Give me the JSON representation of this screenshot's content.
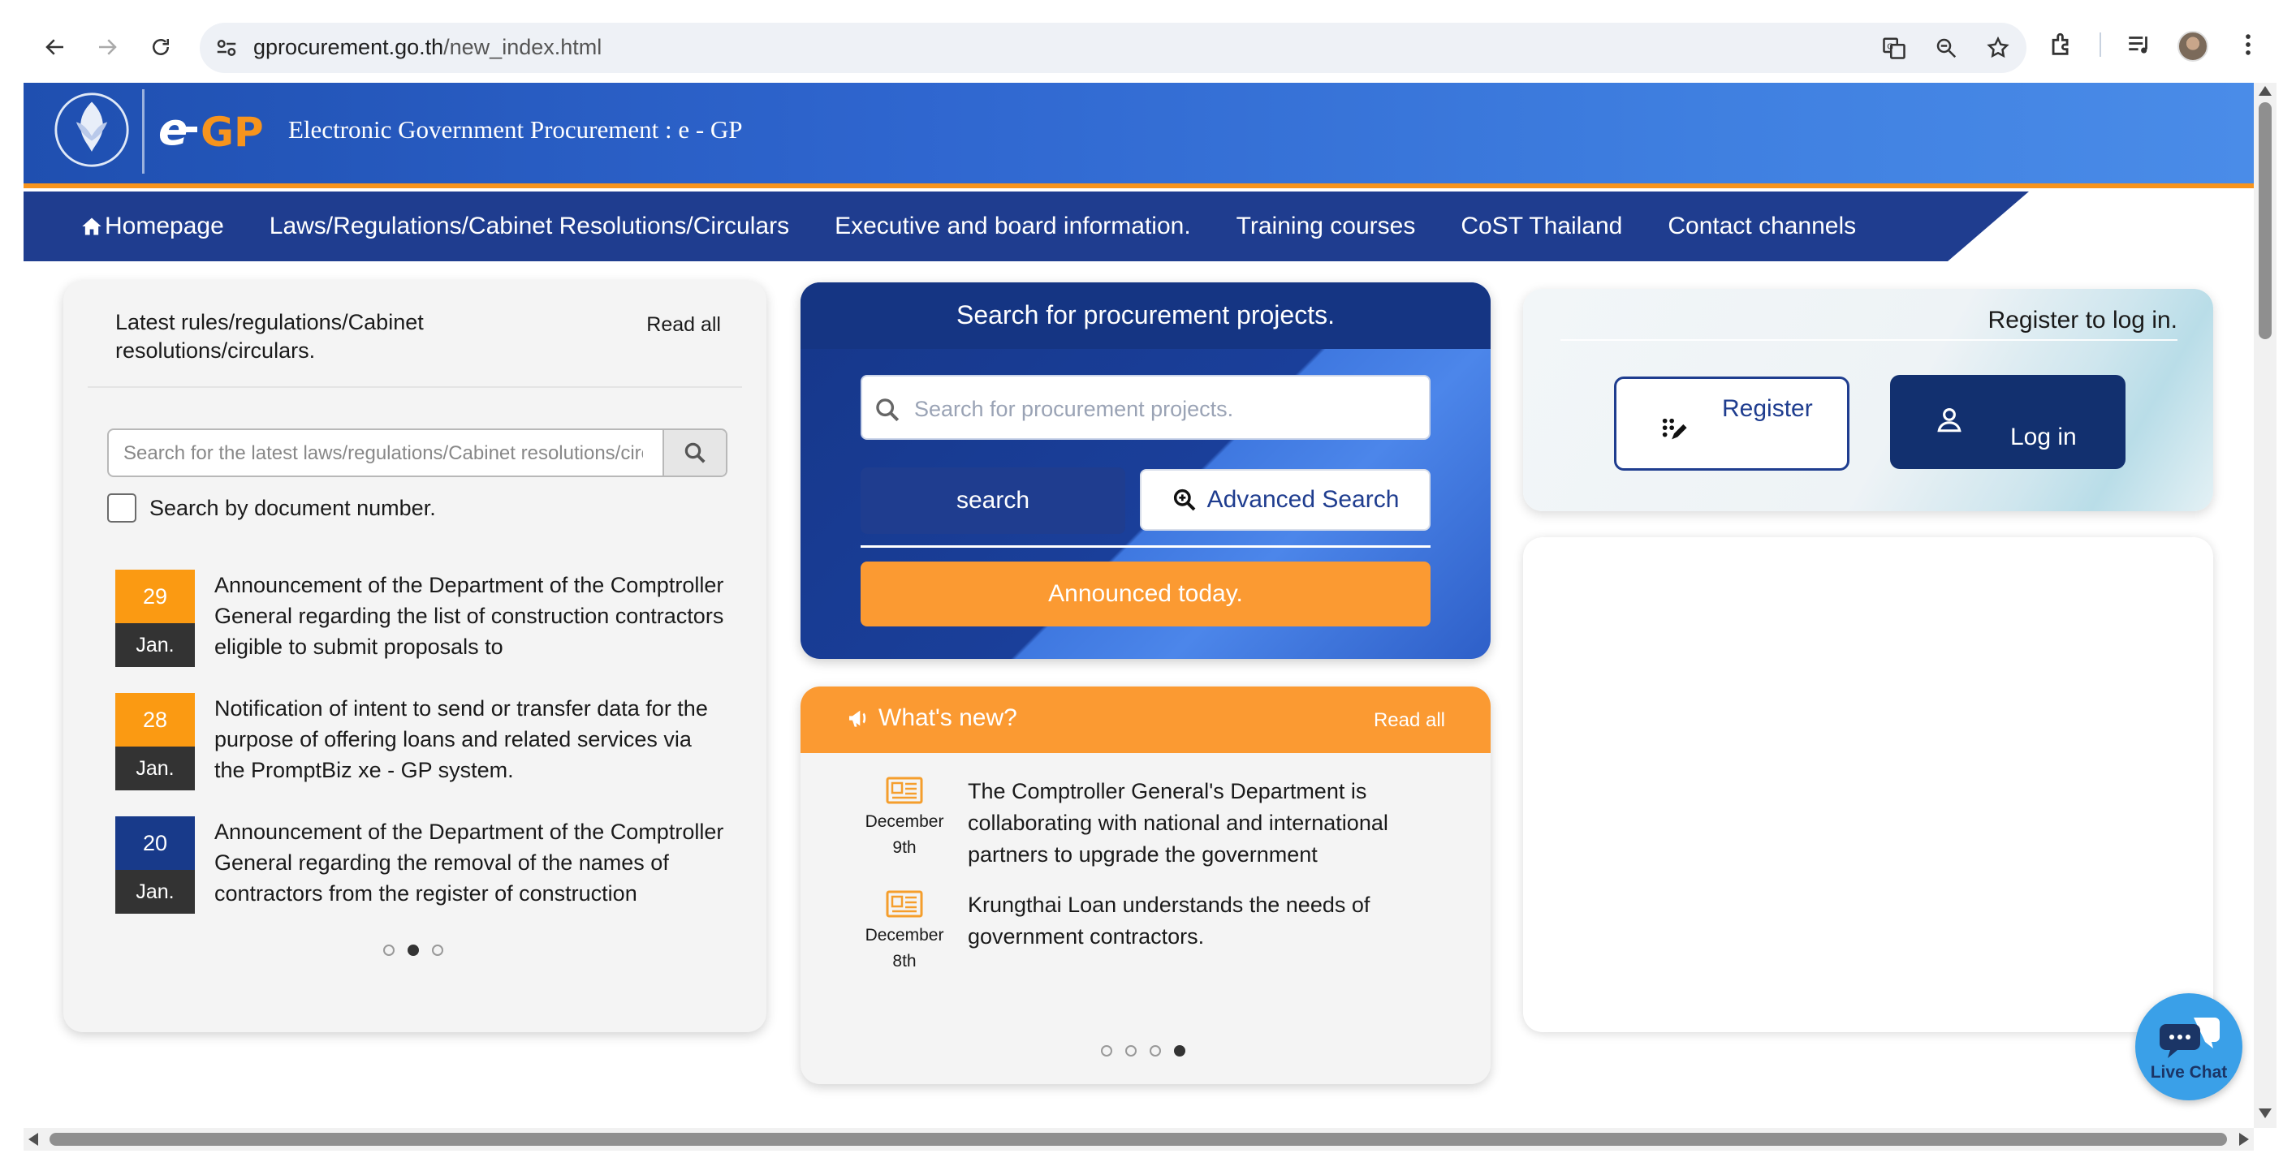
{
  "browser": {
    "url_host": "gprocurement.go.th",
    "url_path": "/new_index.html"
  },
  "header": {
    "title": "Electronic Government Procurement : e - GP",
    "logo_text": "e-GP"
  },
  "nav": {
    "items": [
      {
        "label": "Homepage"
      },
      {
        "label": "Laws/Regulations/Cabinet Resolutions/Circulars"
      },
      {
        "label": "Executive and board information."
      },
      {
        "label": "Training courses"
      },
      {
        "label": "CoST Thailand"
      },
      {
        "label": "Contact channels"
      }
    ]
  },
  "rules": {
    "title": "Latest rules/regulations/Cabinet resolutions/circulars.",
    "read_all": "Read all",
    "search_placeholder": "Search for the latest laws/regulations/Cabinet resolutions/circulars",
    "checkbox_label": "Search by document number.",
    "items": [
      {
        "day": "29",
        "month": "Jan.",
        "badge_color": "#fb9a12",
        "text": "Announcement of the Department of the Comptroller General regarding the list of construction contractors eligible to submit proposals to"
      },
      {
        "day": "28",
        "month": "Jan.",
        "badge_color": "#fb9a12",
        "text": "Notification of intent to send or transfer data for the purpose of offering loans and related services via the PromptBiz xe - GP system."
      },
      {
        "day": "20",
        "month": "Jan.",
        "badge_color": "#183a8a",
        "text": "Announcement of the Department of the Comptroller General regarding the removal of the names of contractors from the register of construction"
      }
    ],
    "pager": {
      "count": 3,
      "active": 1
    }
  },
  "project_search": {
    "title": "Search for procurement projects.",
    "placeholder": "Search for procurement projects.",
    "search_label": "search",
    "advanced_label": "Advanced Search",
    "today_label": "Announced today."
  },
  "news": {
    "title": "What's new?",
    "read_all": "Read all",
    "items": [
      {
        "month": "December",
        "day": "9th",
        "text": "The Comptroller General's Department is collaborating with national and international partners to upgrade the government"
      },
      {
        "month": "December",
        "day": "8th",
        "text": "Krungthai Loan understands the needs of government contractors."
      }
    ],
    "pager": {
      "count": 4,
      "active": 3
    }
  },
  "register": {
    "title": "Register to log in.",
    "register_label": "Register",
    "login_label": "Log in"
  },
  "live_chat": {
    "label": "Live Chat"
  },
  "colors": {
    "primary": "#1f3d8f",
    "accent": "#fb9a32",
    "header_gradient_start": "#1f4fb0"
  }
}
